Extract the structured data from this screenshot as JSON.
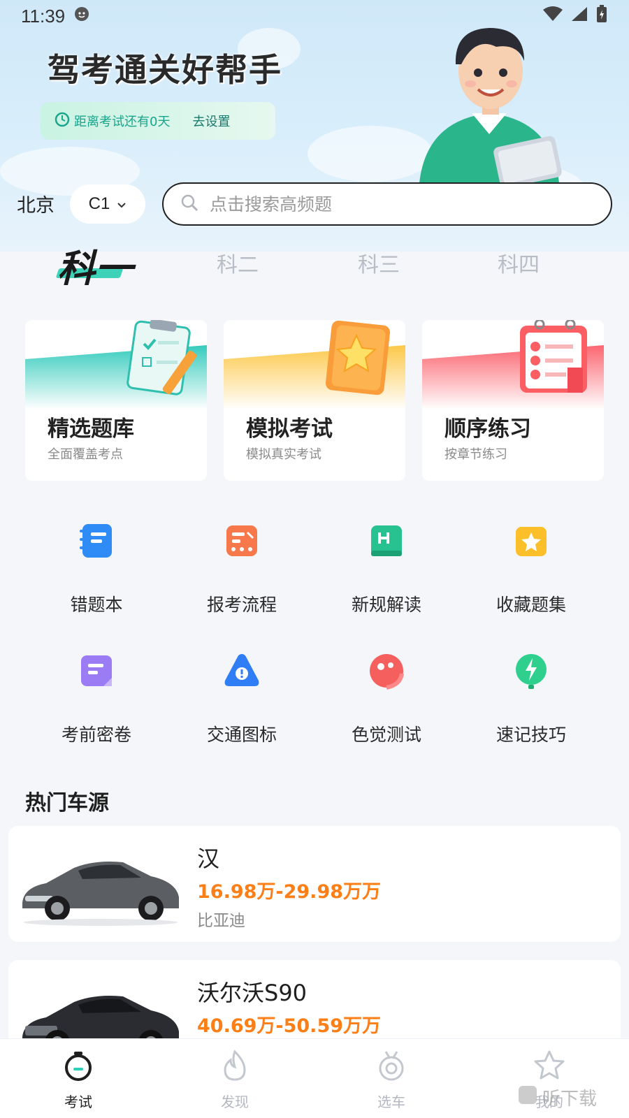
{
  "status_bar": {
    "time": "11:39"
  },
  "hero": {
    "title": "驾考通关好帮手",
    "countdown_text": "距离考试还有0天",
    "countdown_action": "去设置"
  },
  "filters": {
    "city": "北京",
    "license_type": "C1",
    "search_placeholder": "点击搜索高频题"
  },
  "subject_tabs": [
    {
      "label": "科一",
      "active": true
    },
    {
      "label": "科二",
      "active": false
    },
    {
      "label": "科三",
      "active": false
    },
    {
      "label": "科四",
      "active": false
    }
  ],
  "feature_cards": [
    {
      "title": "精选题库",
      "subtitle": "全面覆盖考点",
      "color": "#3fcfc0"
    },
    {
      "title": "模拟考试",
      "subtitle": "模拟真实考试",
      "color": "#fbc94c"
    },
    {
      "title": "顺序练习",
      "subtitle": "按章节练习",
      "color": "#fb6b6e"
    }
  ],
  "tools": [
    {
      "label": "错题本",
      "icon": "notebook-icon",
      "color": "#2f8bf5"
    },
    {
      "label": "报考流程",
      "icon": "flow-icon",
      "color": "#f7794b"
    },
    {
      "label": "新规解读",
      "icon": "rulebook-icon",
      "color": "#27c28f"
    },
    {
      "label": "收藏题集",
      "icon": "star-folder-icon",
      "color": "#fbbf2a"
    },
    {
      "label": "考前密卷",
      "icon": "paper-icon",
      "color": "#9c7cf4"
    },
    {
      "label": "交通图标",
      "icon": "warning-sign-icon",
      "color": "#2f7ef5"
    },
    {
      "label": "色觉测试",
      "icon": "palette-icon",
      "color": "#f5605e"
    },
    {
      "label": "速记技巧",
      "icon": "lightning-icon",
      "color": "#2fcf8e"
    }
  ],
  "hot_cars": {
    "title": "热门车源",
    "items": [
      {
        "name": "汉",
        "price": "16.98万-29.98万万",
        "brand": "比亚迪"
      },
      {
        "name": "沃尔沃S90",
        "price": "40.69万-50.59万万",
        "brand": ""
      }
    ]
  },
  "bottom_nav": [
    {
      "label": "考试",
      "icon": "stopwatch-icon",
      "active": true
    },
    {
      "label": "发现",
      "icon": "flame-icon",
      "active": false
    },
    {
      "label": "选车",
      "icon": "wheel-badge-icon",
      "active": false
    },
    {
      "label": "我的",
      "icon": "star-icon",
      "active": false
    }
  ],
  "watermark": "听下载"
}
